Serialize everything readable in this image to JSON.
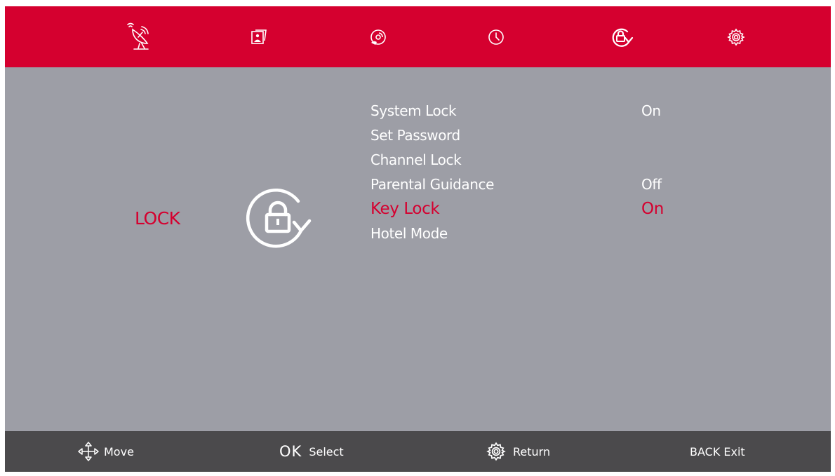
{
  "colors": {
    "accent": "#d5002f",
    "panel": "#9d9ea6",
    "bar": "#4b4a4c",
    "text": "#ffffff",
    "highlight": "#d5002f"
  },
  "top_nav": [
    {
      "icon": "satellite-dish-icon"
    },
    {
      "icon": "picture-icon"
    },
    {
      "icon": "sound-icon"
    },
    {
      "icon": "clock-icon"
    },
    {
      "icon": "lock-icon",
      "active": true
    },
    {
      "icon": "gear-icon"
    }
  ],
  "page": {
    "title": "LOCK",
    "icon": "lock-rotate-icon"
  },
  "menu": {
    "items": [
      {
        "label": "System Lock",
        "value": "On"
      },
      {
        "label": "Set Password",
        "value": ""
      },
      {
        "label": "Channel Lock",
        "value": ""
      },
      {
        "label": "Parental Guidance",
        "value": "Off"
      },
      {
        "label": "Key Lock",
        "value": "On",
        "selected": true
      },
      {
        "label": "Hotel Mode",
        "value": ""
      }
    ]
  },
  "footer": {
    "move_label": "Move",
    "ok_key": "OK",
    "select_label": "Select",
    "return_label": "Return",
    "exit_label": "BACK Exit"
  }
}
